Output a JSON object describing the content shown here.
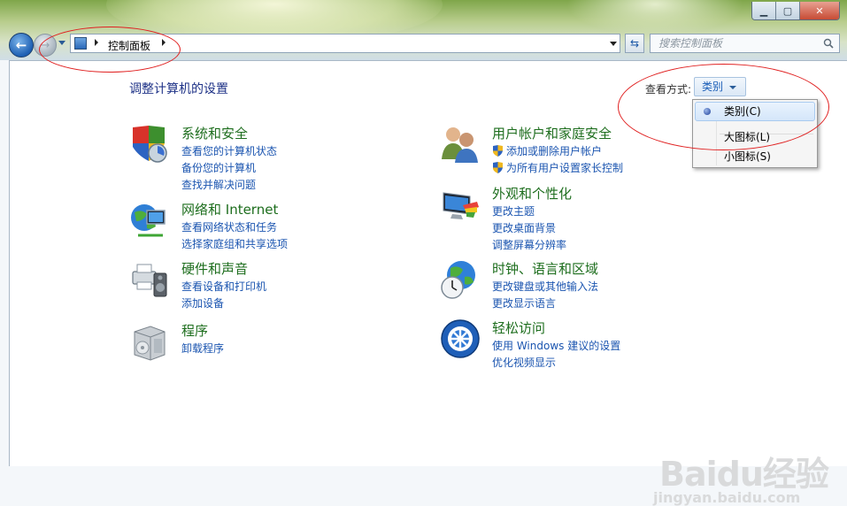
{
  "window": {
    "caption_minimize": "▁",
    "caption_maximize": "▢",
    "caption_close": "✕"
  },
  "nav": {
    "back_glyph": "←",
    "forward_glyph": "→",
    "refresh_glyph": "⇆"
  },
  "address": {
    "crumb": "控制面板"
  },
  "search": {
    "placeholder": "搜索控制面板"
  },
  "page": {
    "title": "调整计算机的设置"
  },
  "view": {
    "label": "查看方式:",
    "selected": "类别",
    "options": [
      "类别(C)",
      "大图标(L)",
      "小图标(S)"
    ]
  },
  "categories_left": [
    {
      "title": "系统和安全",
      "links": [
        "查看您的计算机状态",
        "备份您的计算机",
        "查找并解决问题"
      ]
    },
    {
      "title": "网络和 Internet",
      "links": [
        "查看网络状态和任务",
        "选择家庭组和共享选项"
      ]
    },
    {
      "title": "硬件和声音",
      "links": [
        "查看设备和打印机",
        "添加设备"
      ]
    },
    {
      "title": "程序",
      "links": [
        "卸载程序"
      ]
    }
  ],
  "categories_right": [
    {
      "title": "用户帐户和家庭安全",
      "links": [
        "添加或删除用户帐户",
        "为所有用户设置家长控制"
      ]
    },
    {
      "title": "外观和个性化",
      "links": [
        "更改主题",
        "更改桌面背景",
        "调整屏幕分辨率"
      ]
    },
    {
      "title": "时钟、语言和区域",
      "links": [
        "更改键盘或其他输入法",
        "更改显示语言"
      ]
    },
    {
      "title": "轻松访问",
      "links": [
        "使用 Windows 建议的设置",
        "优化视频显示"
      ]
    }
  ],
  "watermark": {
    "brand": "Baidu经验",
    "url": "jingyan.baidu.com"
  },
  "colors": {
    "category_title": "#1e6e1e",
    "link": "#1b55b0",
    "page_title": "#1e3287",
    "annotation": "#e02020"
  }
}
